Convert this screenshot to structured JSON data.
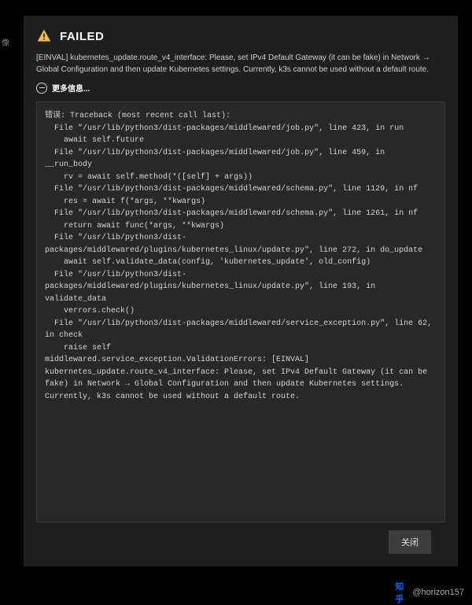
{
  "leftFragment": "像",
  "title": "FAILED",
  "message": "[EINVAL] kubernetes_update.route_v4_interface: Please, set IPv4 Default Gateway (it can be fake) in Network → Global Configuration and then update Kubernetes settings. Currently, k3s cannot be used without a default route.",
  "moreLabel": "更多信息...",
  "traceback": "错误: Traceback (most recent call last):\n  File \"/usr/lib/python3/dist-packages/middlewared/job.py\", line 423, in run\n    await self.future\n  File \"/usr/lib/python3/dist-packages/middlewared/job.py\", line 459, in __run_body\n    rv = await self.method(*([self] + args))\n  File \"/usr/lib/python3/dist-packages/middlewared/schema.py\", line 1129, in nf\n    res = await f(*args, **kwargs)\n  File \"/usr/lib/python3/dist-packages/middlewared/schema.py\", line 1261, in nf\n    return await func(*args, **kwargs)\n  File \"/usr/lib/python3/dist-packages/middlewared/plugins/kubernetes_linux/update.py\", line 272, in do_update\n    await self.validate_data(config, 'kubernetes_update', old_config)\n  File \"/usr/lib/python3/dist-packages/middlewared/plugins/kubernetes_linux/update.py\", line 193, in validate_data\n    verrors.check()\n  File \"/usr/lib/python3/dist-packages/middlewared/service_exception.py\", line 62, in check\n    raise self\nmiddlewared.service_exception.ValidationErrors: [EINVAL] kubernetes_update.route_v4_interface: Please, set IPv4 Default Gateway (it can be fake) in Network → Global Configuration and then update Kubernetes settings. Currently, k3s cannot be used without a default route.\n",
  "closeLabel": "关闭",
  "watermark": {
    "brand": "知乎",
    "user": "@horizon157"
  }
}
